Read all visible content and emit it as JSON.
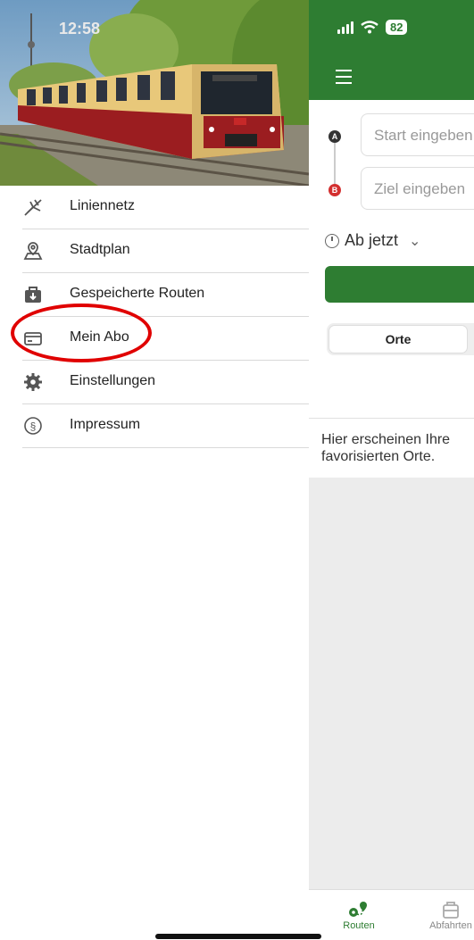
{
  "status_bar": {
    "time": "12:58",
    "battery": "82"
  },
  "drawer": {
    "items": [
      {
        "label": "Liniennetz",
        "icon": "network-map-icon"
      },
      {
        "label": "Stadtplan",
        "icon": "map-pin-icon"
      },
      {
        "label": "Gespeicherte Routen",
        "icon": "saved-routes-icon"
      },
      {
        "label": "Mein Abo",
        "icon": "card-icon"
      },
      {
        "label": "Einstellungen",
        "icon": "gear-icon"
      },
      {
        "label": "Impressum",
        "icon": "section-sign-icon"
      }
    ]
  },
  "trip": {
    "start_placeholder": "Start eingeben",
    "ziel_placeholder": "Ziel eingeben",
    "waypoint_a": "A",
    "waypoint_b": "B",
    "time_label": "Ab jetzt"
  },
  "segments": {
    "orte": "Orte"
  },
  "info_text": "Hier erscheinen Ihre\nfavorisierten Orte.",
  "tabbar": {
    "routen": "Routen",
    "abfahrten": "Abfahrten"
  },
  "colors": {
    "brand_green": "#2e7d32",
    "highlight_red": "#e00000",
    "waypoint_b_red": "#d32f2f"
  }
}
